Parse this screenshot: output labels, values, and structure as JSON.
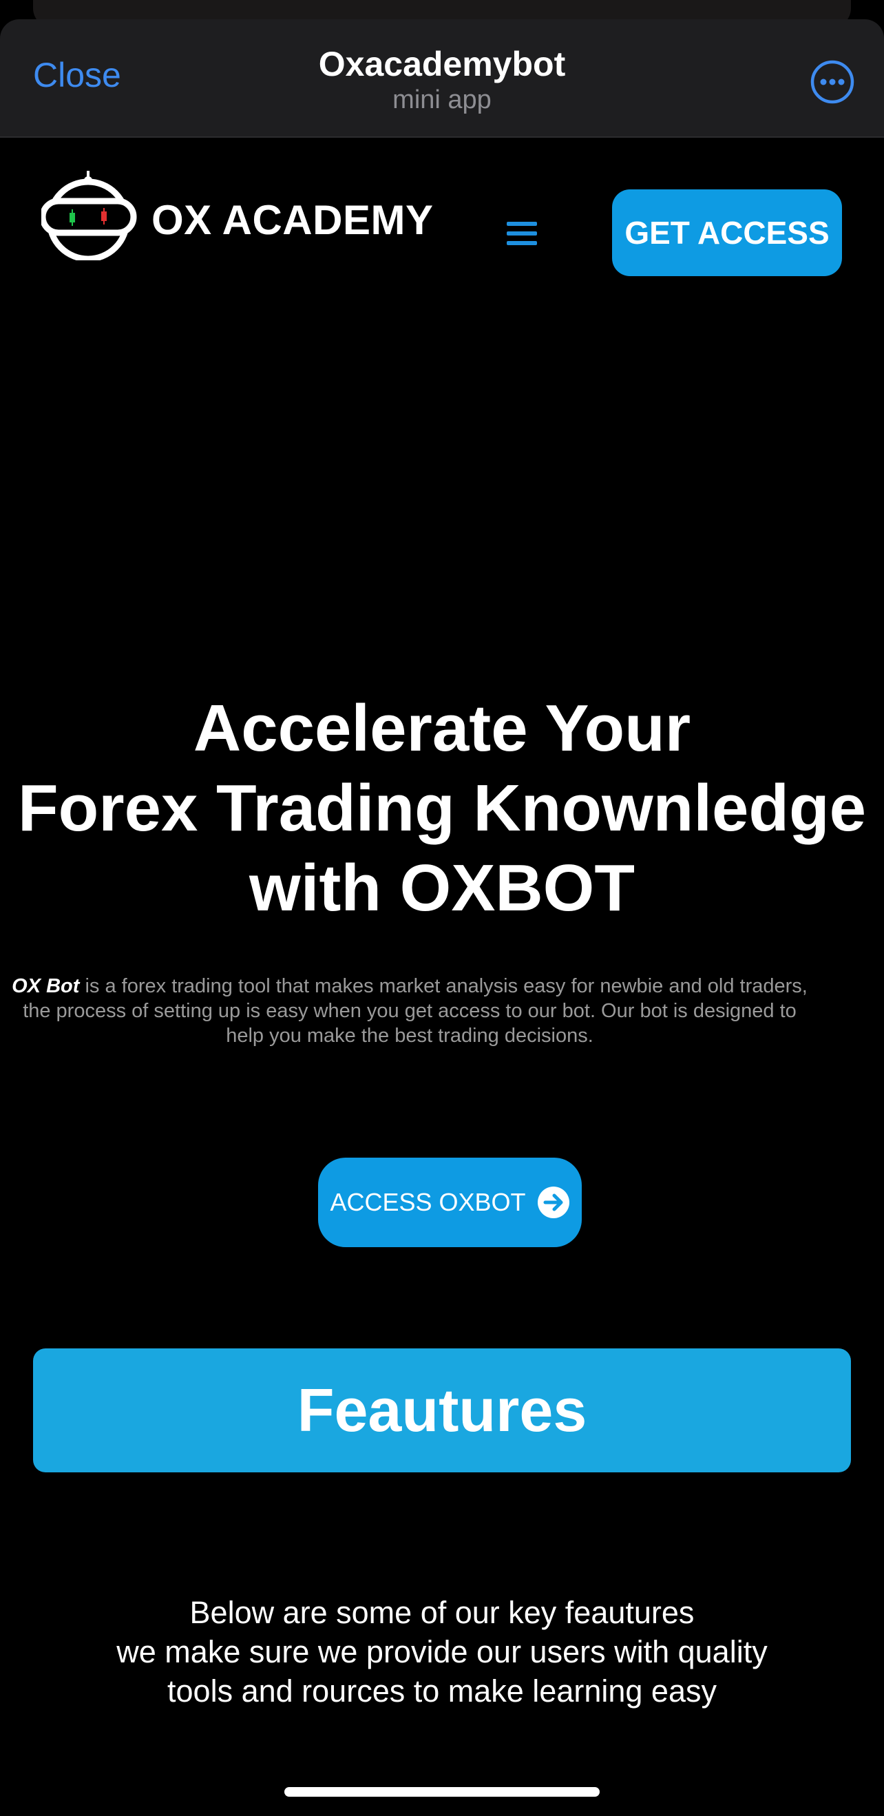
{
  "telegram_header": {
    "close_label": "Close",
    "title": "Oxacademybot",
    "subtitle": "mini app",
    "more_icon": "more-horizontal-circle-icon",
    "accent_color": "#3e8bf0"
  },
  "site_header": {
    "brand": "OX ACADEMY",
    "logo_icon": "robot-head-logo",
    "menu_icon": "hamburger-menu-icon",
    "cta_label": "GET ACCESS"
  },
  "hero": {
    "title_lines": [
      "Accelerate Your",
      "Forex Trading Knownledge",
      "with OXBOT"
    ],
    "description_emphasis": "OX Bot",
    "description_lines": [
      " is a forex trading tool that makes market analysis easy for newbie and old traders,",
      "the process of setting up is easy when you get access to our bot. Our bot is designed to",
      "help you make the best trading decisions."
    ],
    "cta_label": "ACCESS OXBOT",
    "cta_icon": "arrow-right-circle-icon"
  },
  "features": {
    "heading": "Feautures",
    "text_lines": [
      "Below are some of our key feautures",
      "we make sure we provide our users with quality",
      "tools and rources to make learning easy"
    ]
  },
  "colors": {
    "background": "#000000",
    "primary_blue": "#0e9be3",
    "features_blue": "#1aa7e0",
    "muted_text": "#9a9a9a"
  }
}
